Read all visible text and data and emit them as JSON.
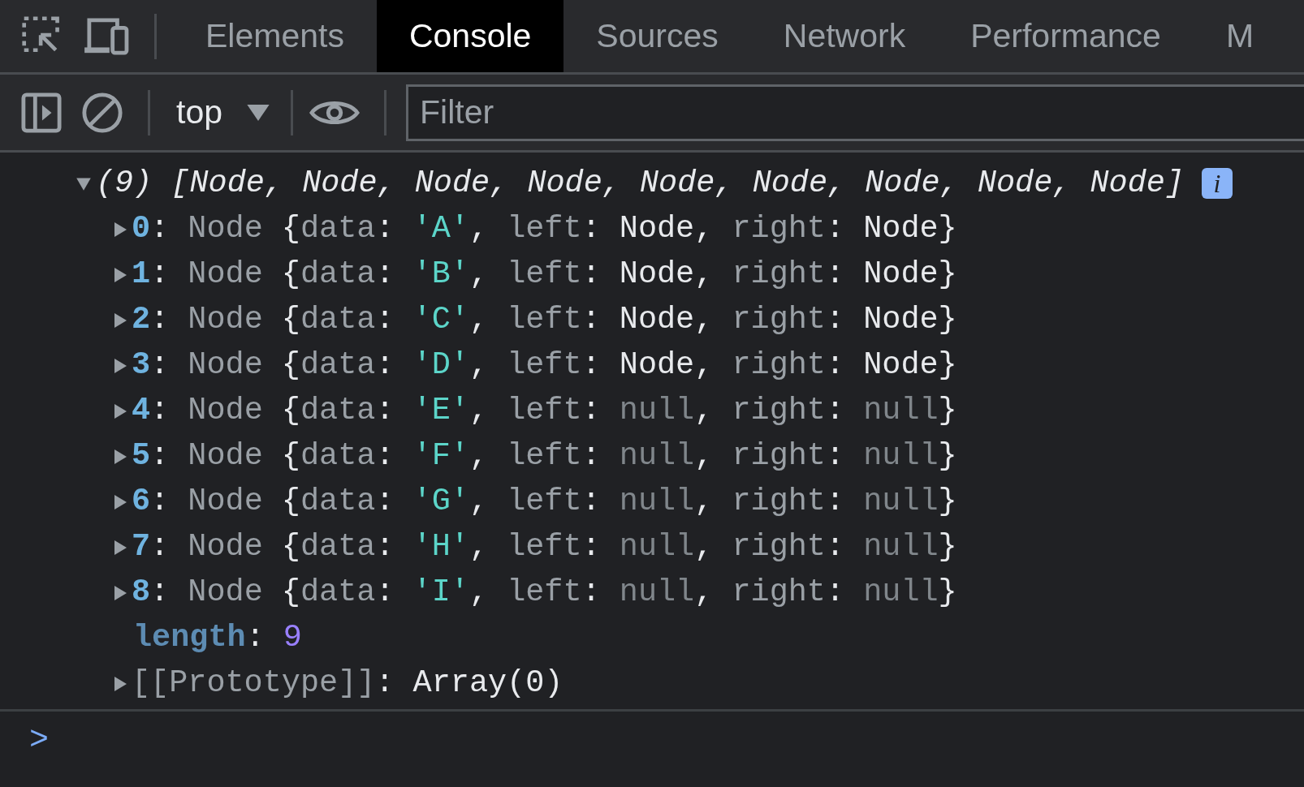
{
  "tabs": [
    {
      "label": "Elements",
      "selected": false
    },
    {
      "label": "Console",
      "selected": true
    },
    {
      "label": "Sources",
      "selected": false
    },
    {
      "label": "Network",
      "selected": false
    },
    {
      "label": "Performance",
      "selected": false
    },
    {
      "label": "M",
      "selected": false
    }
  ],
  "toolbar": {
    "context": "top",
    "filter": {
      "placeholder": "Filter"
    }
  },
  "console": {
    "summary": {
      "expanded": true,
      "count": "(9)",
      "preview": "[Node, Node, Node, Node, Node, Node, Node, Node, Node]",
      "info_badge": "i"
    },
    "items": [
      {
        "expanded": false,
        "tokens": [
          {
            "text": "0",
            "kind": "index"
          },
          {
            "text": ": ",
            "kind": "punct"
          },
          {
            "text": "Node",
            "kind": "class"
          },
          {
            "text": " {",
            "kind": "punct"
          },
          {
            "text": "data",
            "kind": "key"
          },
          {
            "text": ": ",
            "kind": "punct"
          },
          {
            "text": "'A'",
            "kind": "string"
          },
          {
            "text": ", ",
            "kind": "punct"
          },
          {
            "text": "left",
            "kind": "key"
          },
          {
            "text": ": ",
            "kind": "punct"
          },
          {
            "text": "Node",
            "kind": "object"
          },
          {
            "text": ", ",
            "kind": "punct"
          },
          {
            "text": "right",
            "kind": "key"
          },
          {
            "text": ": ",
            "kind": "punct"
          },
          {
            "text": "Node",
            "kind": "object"
          },
          {
            "text": "}",
            "kind": "punct"
          }
        ]
      },
      {
        "expanded": false,
        "tokens": [
          {
            "text": "1",
            "kind": "index"
          },
          {
            "text": ": ",
            "kind": "punct"
          },
          {
            "text": "Node",
            "kind": "class"
          },
          {
            "text": " {",
            "kind": "punct"
          },
          {
            "text": "data",
            "kind": "key"
          },
          {
            "text": ": ",
            "kind": "punct"
          },
          {
            "text": "'B'",
            "kind": "string"
          },
          {
            "text": ", ",
            "kind": "punct"
          },
          {
            "text": "left",
            "kind": "key"
          },
          {
            "text": ": ",
            "kind": "punct"
          },
          {
            "text": "Node",
            "kind": "object"
          },
          {
            "text": ", ",
            "kind": "punct"
          },
          {
            "text": "right",
            "kind": "key"
          },
          {
            "text": ": ",
            "kind": "punct"
          },
          {
            "text": "Node",
            "kind": "object"
          },
          {
            "text": "}",
            "kind": "punct"
          }
        ]
      },
      {
        "expanded": false,
        "tokens": [
          {
            "text": "2",
            "kind": "index"
          },
          {
            "text": ": ",
            "kind": "punct"
          },
          {
            "text": "Node",
            "kind": "class"
          },
          {
            "text": " {",
            "kind": "punct"
          },
          {
            "text": "data",
            "kind": "key"
          },
          {
            "text": ": ",
            "kind": "punct"
          },
          {
            "text": "'C'",
            "kind": "string"
          },
          {
            "text": ", ",
            "kind": "punct"
          },
          {
            "text": "left",
            "kind": "key"
          },
          {
            "text": ": ",
            "kind": "punct"
          },
          {
            "text": "Node",
            "kind": "object"
          },
          {
            "text": ", ",
            "kind": "punct"
          },
          {
            "text": "right",
            "kind": "key"
          },
          {
            "text": ": ",
            "kind": "punct"
          },
          {
            "text": "Node",
            "kind": "object"
          },
          {
            "text": "}",
            "kind": "punct"
          }
        ]
      },
      {
        "expanded": false,
        "tokens": [
          {
            "text": "3",
            "kind": "index"
          },
          {
            "text": ": ",
            "kind": "punct"
          },
          {
            "text": "Node",
            "kind": "class"
          },
          {
            "text": " {",
            "kind": "punct"
          },
          {
            "text": "data",
            "kind": "key"
          },
          {
            "text": ": ",
            "kind": "punct"
          },
          {
            "text": "'D'",
            "kind": "string"
          },
          {
            "text": ", ",
            "kind": "punct"
          },
          {
            "text": "left",
            "kind": "key"
          },
          {
            "text": ": ",
            "kind": "punct"
          },
          {
            "text": "Node",
            "kind": "object"
          },
          {
            "text": ", ",
            "kind": "punct"
          },
          {
            "text": "right",
            "kind": "key"
          },
          {
            "text": ": ",
            "kind": "punct"
          },
          {
            "text": "Node",
            "kind": "object"
          },
          {
            "text": "}",
            "kind": "punct"
          }
        ]
      },
      {
        "expanded": false,
        "tokens": [
          {
            "text": "4",
            "kind": "index"
          },
          {
            "text": ": ",
            "kind": "punct"
          },
          {
            "text": "Node",
            "kind": "class"
          },
          {
            "text": " {",
            "kind": "punct"
          },
          {
            "text": "data",
            "kind": "key"
          },
          {
            "text": ": ",
            "kind": "punct"
          },
          {
            "text": "'E'",
            "kind": "string"
          },
          {
            "text": ", ",
            "kind": "punct"
          },
          {
            "text": "left",
            "kind": "key"
          },
          {
            "text": ": ",
            "kind": "punct"
          },
          {
            "text": "null",
            "kind": "null"
          },
          {
            "text": ", ",
            "kind": "punct"
          },
          {
            "text": "right",
            "kind": "key"
          },
          {
            "text": ": ",
            "kind": "punct"
          },
          {
            "text": "null",
            "kind": "null"
          },
          {
            "text": "}",
            "kind": "punct"
          }
        ]
      },
      {
        "expanded": false,
        "tokens": [
          {
            "text": "5",
            "kind": "index"
          },
          {
            "text": ": ",
            "kind": "punct"
          },
          {
            "text": "Node",
            "kind": "class"
          },
          {
            "text": " {",
            "kind": "punct"
          },
          {
            "text": "data",
            "kind": "key"
          },
          {
            "text": ": ",
            "kind": "punct"
          },
          {
            "text": "'F'",
            "kind": "string"
          },
          {
            "text": ", ",
            "kind": "punct"
          },
          {
            "text": "left",
            "kind": "key"
          },
          {
            "text": ": ",
            "kind": "punct"
          },
          {
            "text": "null",
            "kind": "null"
          },
          {
            "text": ", ",
            "kind": "punct"
          },
          {
            "text": "right",
            "kind": "key"
          },
          {
            "text": ": ",
            "kind": "punct"
          },
          {
            "text": "null",
            "kind": "null"
          },
          {
            "text": "}",
            "kind": "punct"
          }
        ]
      },
      {
        "expanded": false,
        "tokens": [
          {
            "text": "6",
            "kind": "index"
          },
          {
            "text": ": ",
            "kind": "punct"
          },
          {
            "text": "Node",
            "kind": "class"
          },
          {
            "text": " {",
            "kind": "punct"
          },
          {
            "text": "data",
            "kind": "key"
          },
          {
            "text": ": ",
            "kind": "punct"
          },
          {
            "text": "'G'",
            "kind": "string"
          },
          {
            "text": ", ",
            "kind": "punct"
          },
          {
            "text": "left",
            "kind": "key"
          },
          {
            "text": ": ",
            "kind": "punct"
          },
          {
            "text": "null",
            "kind": "null"
          },
          {
            "text": ", ",
            "kind": "punct"
          },
          {
            "text": "right",
            "kind": "key"
          },
          {
            "text": ": ",
            "kind": "punct"
          },
          {
            "text": "null",
            "kind": "null"
          },
          {
            "text": "}",
            "kind": "punct"
          }
        ]
      },
      {
        "expanded": false,
        "tokens": [
          {
            "text": "7",
            "kind": "index"
          },
          {
            "text": ": ",
            "kind": "punct"
          },
          {
            "text": "Node",
            "kind": "class"
          },
          {
            "text": " {",
            "kind": "punct"
          },
          {
            "text": "data",
            "kind": "key"
          },
          {
            "text": ": ",
            "kind": "punct"
          },
          {
            "text": "'H'",
            "kind": "string"
          },
          {
            "text": ", ",
            "kind": "punct"
          },
          {
            "text": "left",
            "kind": "key"
          },
          {
            "text": ": ",
            "kind": "punct"
          },
          {
            "text": "null",
            "kind": "null"
          },
          {
            "text": ", ",
            "kind": "punct"
          },
          {
            "text": "right",
            "kind": "key"
          },
          {
            "text": ": ",
            "kind": "punct"
          },
          {
            "text": "null",
            "kind": "null"
          },
          {
            "text": "}",
            "kind": "punct"
          }
        ]
      },
      {
        "expanded": false,
        "tokens": [
          {
            "text": "8",
            "kind": "index"
          },
          {
            "text": ": ",
            "kind": "punct"
          },
          {
            "text": "Node",
            "kind": "class"
          },
          {
            "text": " {",
            "kind": "punct"
          },
          {
            "text": "data",
            "kind": "key"
          },
          {
            "text": ": ",
            "kind": "punct"
          },
          {
            "text": "'I'",
            "kind": "string"
          },
          {
            "text": ", ",
            "kind": "punct"
          },
          {
            "text": "left",
            "kind": "key"
          },
          {
            "text": ": ",
            "kind": "punct"
          },
          {
            "text": "null",
            "kind": "null"
          },
          {
            "text": ", ",
            "kind": "punct"
          },
          {
            "text": "right",
            "kind": "key"
          },
          {
            "text": ": ",
            "kind": "punct"
          },
          {
            "text": "null",
            "kind": "null"
          },
          {
            "text": "}",
            "kind": "punct"
          }
        ]
      }
    ],
    "length": {
      "tokens": [
        {
          "text": "length",
          "kind": "lenkey"
        },
        {
          "text": ": ",
          "kind": "punct"
        },
        {
          "text": "9",
          "kind": "number"
        }
      ]
    },
    "prototype": {
      "expanded": false,
      "tokens": [
        {
          "text": "[[Prototype]]",
          "kind": "key"
        },
        {
          "text": ": ",
          "kind": "punct"
        },
        {
          "text": "Array(0)",
          "kind": "object"
        }
      ]
    },
    "prompt": ">"
  }
}
